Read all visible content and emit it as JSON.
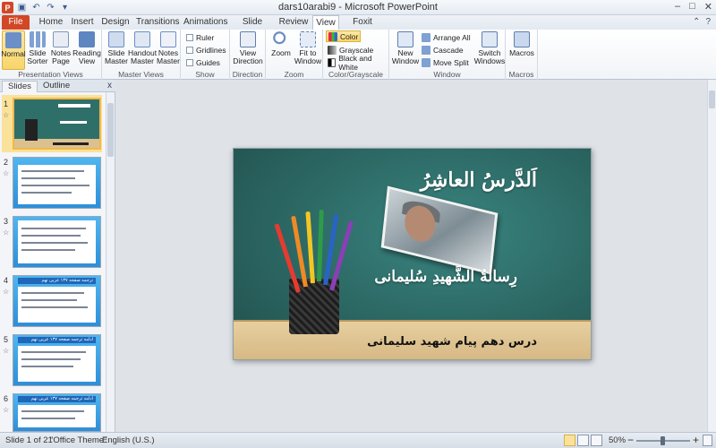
{
  "window": {
    "title": "dars10arabi9 - Microsoft PowerPoint",
    "controls": [
      "–",
      "□",
      "✕"
    ]
  },
  "ribbon_tabs": [
    "File",
    "Home",
    "Insert",
    "Design",
    "Transitions",
    "Animations",
    "Slide Show",
    "Review",
    "View",
    "Foxit PDF"
  ],
  "active_tab": "View",
  "groups": {
    "presentation_views": {
      "label": "Presentation Views",
      "buttons": [
        {
          "label": "Normal",
          "selected": true,
          "icon": "normal-view-icon"
        },
        {
          "label": "Slide Sorter",
          "icon": "slide-sorter-icon"
        },
        {
          "label": "Notes Page",
          "icon": "notes-page-icon"
        },
        {
          "label": "Reading View",
          "icon": "reading-view-icon"
        }
      ]
    },
    "master_views": {
      "label": "Master Views",
      "buttons": [
        {
          "label": "Slide Master",
          "icon": "slide-master-icon"
        },
        {
          "label": "Handout Master",
          "icon": "handout-master-icon"
        },
        {
          "label": "Notes Master",
          "icon": "notes-master-icon"
        }
      ]
    },
    "show": {
      "label": "Show",
      "checks": [
        {
          "label": "Ruler",
          "checked": false
        },
        {
          "label": "Gridlines",
          "checked": false
        },
        {
          "label": "Guides",
          "checked": false
        }
      ]
    },
    "direction": {
      "label": "Direction",
      "buttons": [
        {
          "label": "View Direction",
          "icon": "view-direction-icon"
        }
      ]
    },
    "zoom": {
      "label": "Zoom",
      "buttons": [
        {
          "label": "Zoom",
          "icon": "zoom-icon"
        },
        {
          "label": "Fit to Window",
          "icon": "fit-to-window-icon"
        }
      ]
    },
    "color_grayscale": {
      "label": "Color/Grayscale",
      "options": [
        {
          "label": "Color",
          "selected": true
        },
        {
          "label": "Grayscale"
        },
        {
          "label": "Black and White"
        }
      ]
    },
    "window": {
      "label": "Window",
      "buttons": [
        {
          "label": "New Window",
          "icon": "new-window-icon"
        },
        {
          "label": "Arrange All",
          "icon": "arrange-all-icon"
        },
        {
          "label": "Cascade",
          "icon": "cascade-icon"
        },
        {
          "label": "Move Split",
          "icon": "move-split-icon"
        },
        {
          "label": "Switch Windows",
          "icon": "switch-windows-icon"
        }
      ]
    },
    "macros": {
      "label": "Macros",
      "buttons": [
        {
          "label": "Macros",
          "icon": "macros-icon"
        }
      ]
    }
  },
  "panel": {
    "tabs": [
      "Slides",
      "Outline"
    ],
    "active_tab": "Slides",
    "close": "x",
    "slides": [
      {
        "number": "1",
        "selected": true
      },
      {
        "number": "2"
      },
      {
        "number": "3"
      },
      {
        "number": "4",
        "title": "ترجمه صفحه ۱۳۷ عربی نهم"
      },
      {
        "number": "5",
        "title": "ادامه ترجمه صفحه ۱۳۷ عربی نهم"
      },
      {
        "number": "6",
        "title": "ادامه ترجمه صفحه ۱۳۷ عربی نهم"
      }
    ]
  },
  "slide": {
    "title": "اَلدَّرسُ العاشِرُ",
    "subtitle": "رِسالةُ الشَّهیدِ سُلیمانی",
    "caption": "درس دهم پیام شهید سلیمانی"
  },
  "status": {
    "slide_info": "Slide 1 of 21",
    "theme": "\"Office Theme\"",
    "language": "English (U.S.)",
    "zoom": "50%",
    "zoom_level": 0.5
  },
  "colors": {
    "file_tab": "#d24726",
    "selected_highlight": "#fbe29b",
    "slide_board": "#2f6f6a"
  }
}
